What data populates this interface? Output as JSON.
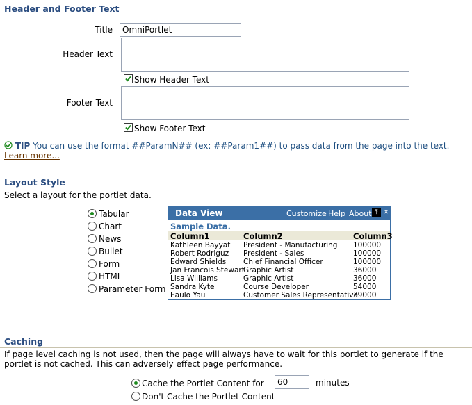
{
  "header_footer": {
    "section_title": "Header and Footer Text",
    "title_label": "Title",
    "title_value": "OmniPortlet",
    "header_label": "Header Text",
    "header_value": "",
    "show_header_label": "Show Header Text",
    "show_header_checked": true,
    "footer_label": "Footer Text",
    "footer_value": "",
    "show_footer_label": "Show Footer Text",
    "show_footer_checked": true,
    "tip_label": "TIP",
    "tip_text": "You can use the format ##ParamN## (ex: ##Param1##) to pass data from the page into the text.",
    "tip_link": "Learn more..."
  },
  "layout_style": {
    "section_title": "Layout Style",
    "instruction": "Select a layout for the portlet data.",
    "options": [
      "Tabular",
      "Chart",
      "News",
      "Bullet",
      "Form",
      "HTML",
      "Parameter Form"
    ],
    "selected": "Tabular"
  },
  "data_view": {
    "title": "Data View",
    "links": [
      "Customize",
      "Help",
      "About"
    ],
    "sample_label": "Sample Data.",
    "columns": [
      "Column1",
      "Column2",
      "Column3"
    ],
    "rows": [
      [
        "Kathleen Bayyat",
        "President - Manufacturing",
        "100000"
      ],
      [
        "Robert Rodriguz",
        "President - Sales",
        "100000"
      ],
      [
        "Edward Shields",
        "Chief Financial Officer",
        "100000"
      ],
      [
        "Jan Francois Stewart",
        "Graphic Artist",
        "36000"
      ],
      [
        "Lisa Williams",
        "Graphic Artist",
        "36000"
      ],
      [
        "Sandra Kyte",
        "Course Developer",
        "54000"
      ],
      [
        "Eaulo Yau",
        "Customer Sales Representative",
        "39000"
      ]
    ]
  },
  "caching": {
    "section_title": "Caching",
    "description": "If page level caching is not used, then the page will always have to wait for this portlet to generate if the portlet is not cached. This can adversely effect page performance.",
    "option_cache_label": "Cache the Portlet Content for",
    "minutes_value": "60",
    "minutes_label": "minutes",
    "option_nocache_label": "Don't Cache the Portlet Content",
    "selected": "cache"
  },
  "colors": {
    "section_title": "#2b4d80",
    "accent": "#3b6fa6",
    "link": "#663300",
    "check": "#1e8a1e"
  }
}
